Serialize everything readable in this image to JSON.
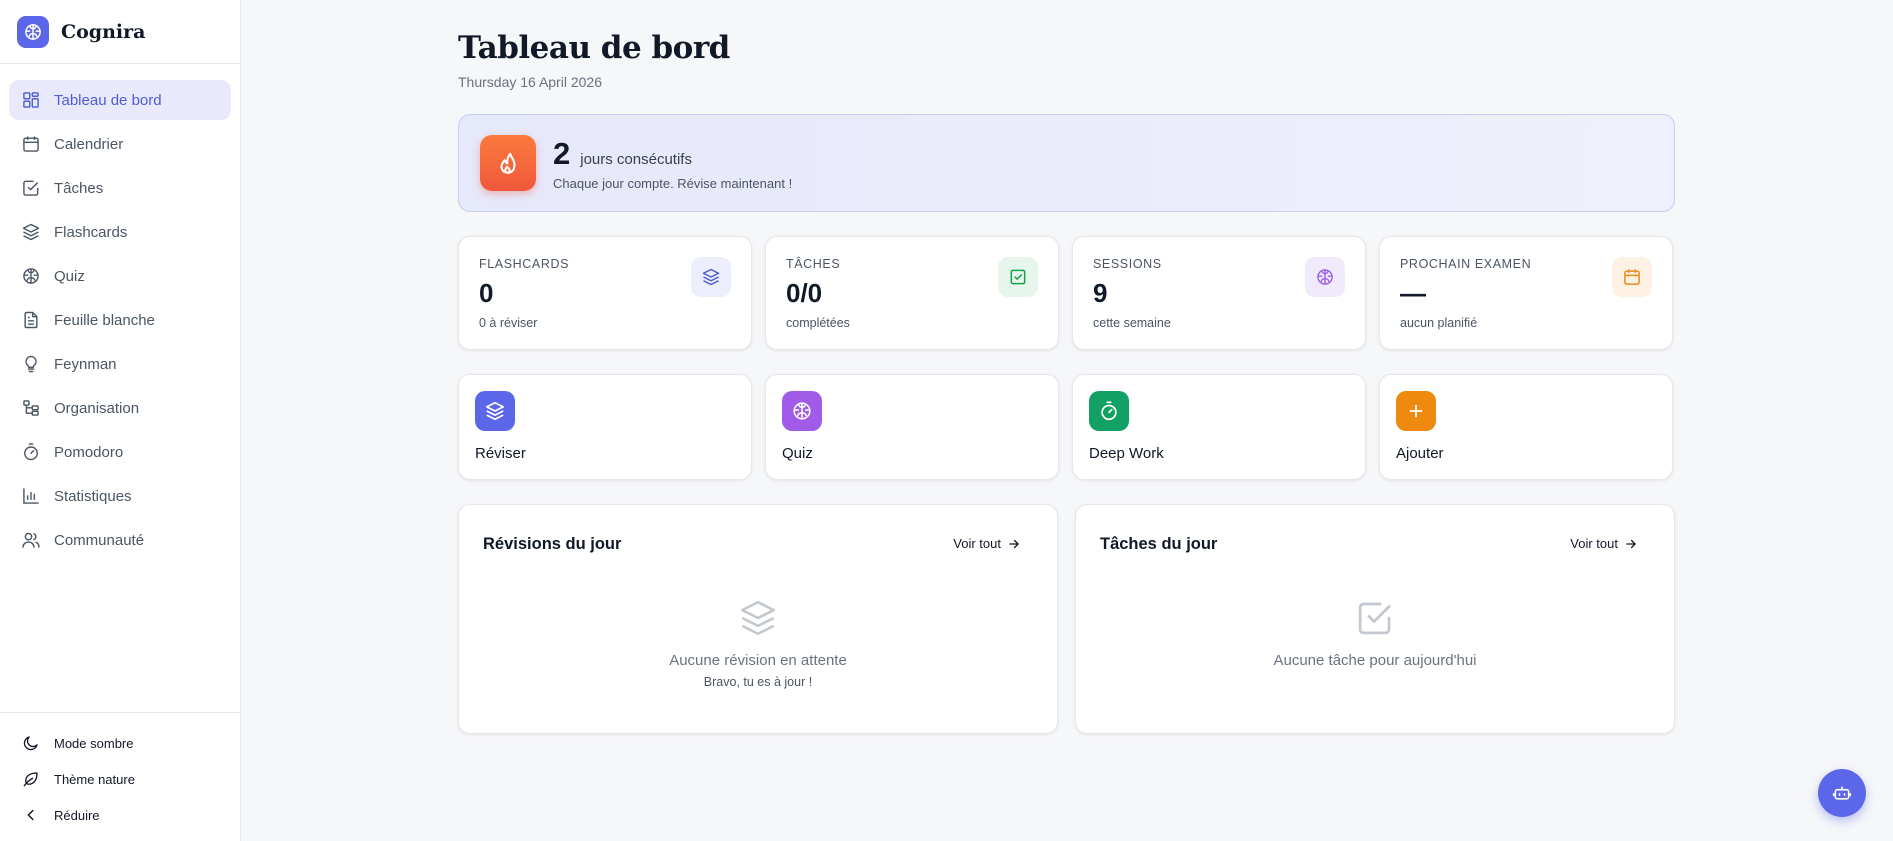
{
  "app": {
    "name": "Cognira"
  },
  "sidebar": {
    "items": [
      {
        "label": "Tableau de bord",
        "icon": "dashboard-icon",
        "active": true
      },
      {
        "label": "Calendrier",
        "icon": "calendar-icon"
      },
      {
        "label": "Tâches",
        "icon": "check-square-icon"
      },
      {
        "label": "Flashcards",
        "icon": "layers-icon"
      },
      {
        "label": "Quiz",
        "icon": "brain-icon"
      },
      {
        "label": "Feuille blanche",
        "icon": "document-icon"
      },
      {
        "label": "Feynman",
        "icon": "lightbulb-icon"
      },
      {
        "label": "Organisation",
        "icon": "hierarchy-icon"
      },
      {
        "label": "Pomodoro",
        "icon": "timer-icon"
      },
      {
        "label": "Statistiques",
        "icon": "bar-chart-icon"
      },
      {
        "label": "Communauté",
        "icon": "users-icon"
      }
    ],
    "bottom": {
      "dark_mode": "Mode sombre",
      "nature_theme": "Thème nature",
      "collapse": "Réduire"
    }
  },
  "header": {
    "title": "Tableau de bord",
    "date": "Thursday 16 April 2026"
  },
  "streak": {
    "count": "2",
    "label": "jours consécutifs",
    "subtitle": "Chaque jour compte. Révise maintenant !"
  },
  "stats": [
    {
      "label": "FLASHCARDS",
      "value": "0",
      "sub": "0 à réviser",
      "icon": "layers-icon",
      "color": "#4f5bd5",
      "bg": "#eceefc"
    },
    {
      "label": "TÂCHES",
      "value": "0/0",
      "sub": "complétées",
      "icon": "check-square-icon",
      "color": "#16a34a",
      "bg": "#e6f6ec"
    },
    {
      "label": "SESSIONS",
      "value": "9",
      "sub": "cette semaine",
      "icon": "brain-icon",
      "color": "#9b5de5",
      "bg": "#f1eafc"
    },
    {
      "label": "PROCHAIN EXAMEN",
      "value": "—",
      "sub": "aucun planifié",
      "icon": "calendar-icon",
      "color": "#ea8a1a",
      "bg": "#fdf1e3"
    }
  ],
  "actions": [
    {
      "label": "Réviser",
      "icon": "layers-icon",
      "color": "#5b67e8"
    },
    {
      "label": "Quiz",
      "icon": "brain-icon",
      "color": "#a05ce8"
    },
    {
      "label": "Deep Work",
      "icon": "timer-icon",
      "color": "#12a064"
    },
    {
      "label": "Ajouter",
      "icon": "plus-icon",
      "color": "#ee8a10"
    }
  ],
  "panels": {
    "reviews": {
      "title": "Révisions du jour",
      "link": "Voir tout",
      "empty_title": "Aucune révision en attente",
      "empty_sub": "Bravo, tu es à jour !"
    },
    "tasks": {
      "title": "Tâches du jour",
      "link": "Voir tout",
      "empty_title": "Aucune tâche pour aujourd'hui"
    }
  }
}
